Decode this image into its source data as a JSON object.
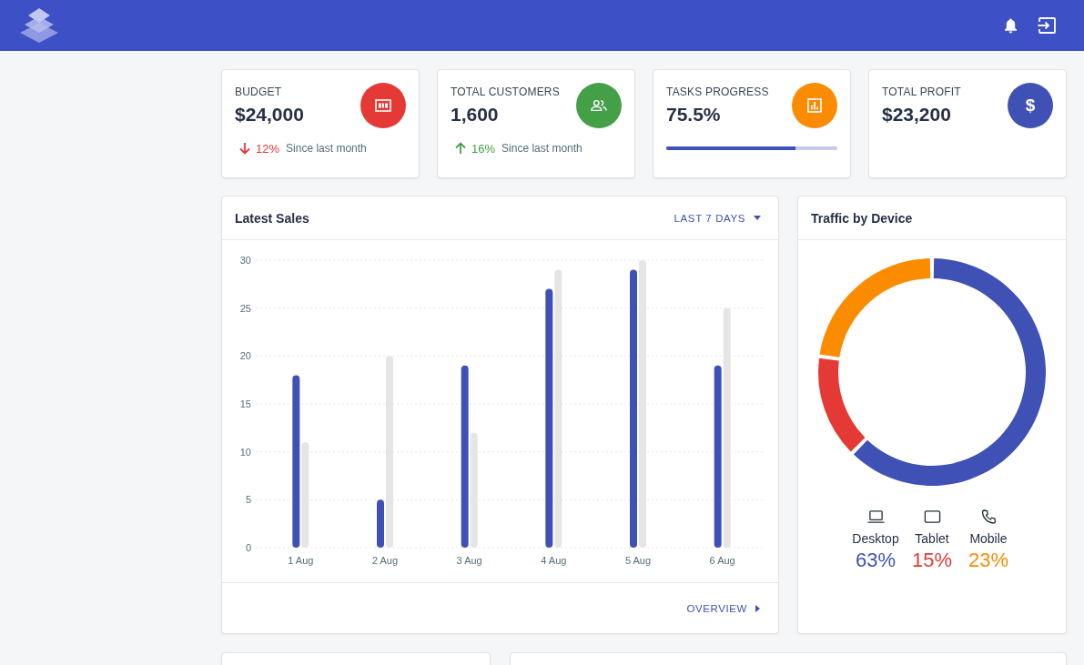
{
  "cards": [
    {
      "kind": "trend",
      "title": "BUDGET",
      "value": "$24,000",
      "color": "#e53935",
      "trend": {
        "rising": false,
        "change": "12%",
        "note": "Since last month"
      }
    },
    {
      "kind": "trend",
      "title": "TOTAL CUSTOMERS",
      "value": "1,600",
      "color": "#43a047",
      "trend": {
        "rising": true,
        "change": "16%",
        "note": "Since last month"
      }
    },
    {
      "kind": "progress",
      "title": "TASKS PROGRESS",
      "value": "75.5%",
      "color": "#fb8c00",
      "level": 0.755
    },
    {
      "kind": "plain",
      "title": "TOTAL PROFIT",
      "value": "$23,200",
      "color": "#3f51b5",
      "symbol": "$"
    }
  ],
  "latest_sales": {
    "title": "Latest Sales",
    "range_button": "LAST 7 DAYS",
    "footer_button": "OVERVIEW",
    "chart_data": {
      "type": "bar",
      "categories": [
        "1 Aug",
        "2 Aug",
        "3 Aug",
        "4 Aug",
        "5 Aug",
        "6 Aug"
      ],
      "series": [
        {
          "color": "#3f51b5",
          "values": [
            18,
            5,
            19,
            27,
            29,
            19
          ]
        },
        {
          "color": "#e5e5e5",
          "values": [
            11,
            20,
            12,
            29,
            30,
            25
          ]
        }
      ],
      "ylim": [
        0,
        30
      ],
      "yticks": [
        0,
        5,
        10,
        15,
        20,
        25,
        30
      ],
      "grid": true
    }
  },
  "traffic": {
    "title": "Traffic by Device",
    "chart_data": {
      "type": "donut",
      "values": [
        63,
        15,
        23
      ]
    },
    "devices": [
      {
        "label": "Desktop",
        "share": "63%",
        "color": "#3f51b5"
      },
      {
        "label": "Tablet",
        "share": "15%",
        "color": "#e53935"
      },
      {
        "label": "Mobile",
        "share": "23%",
        "color": "#fb8c00"
      }
    ]
  }
}
